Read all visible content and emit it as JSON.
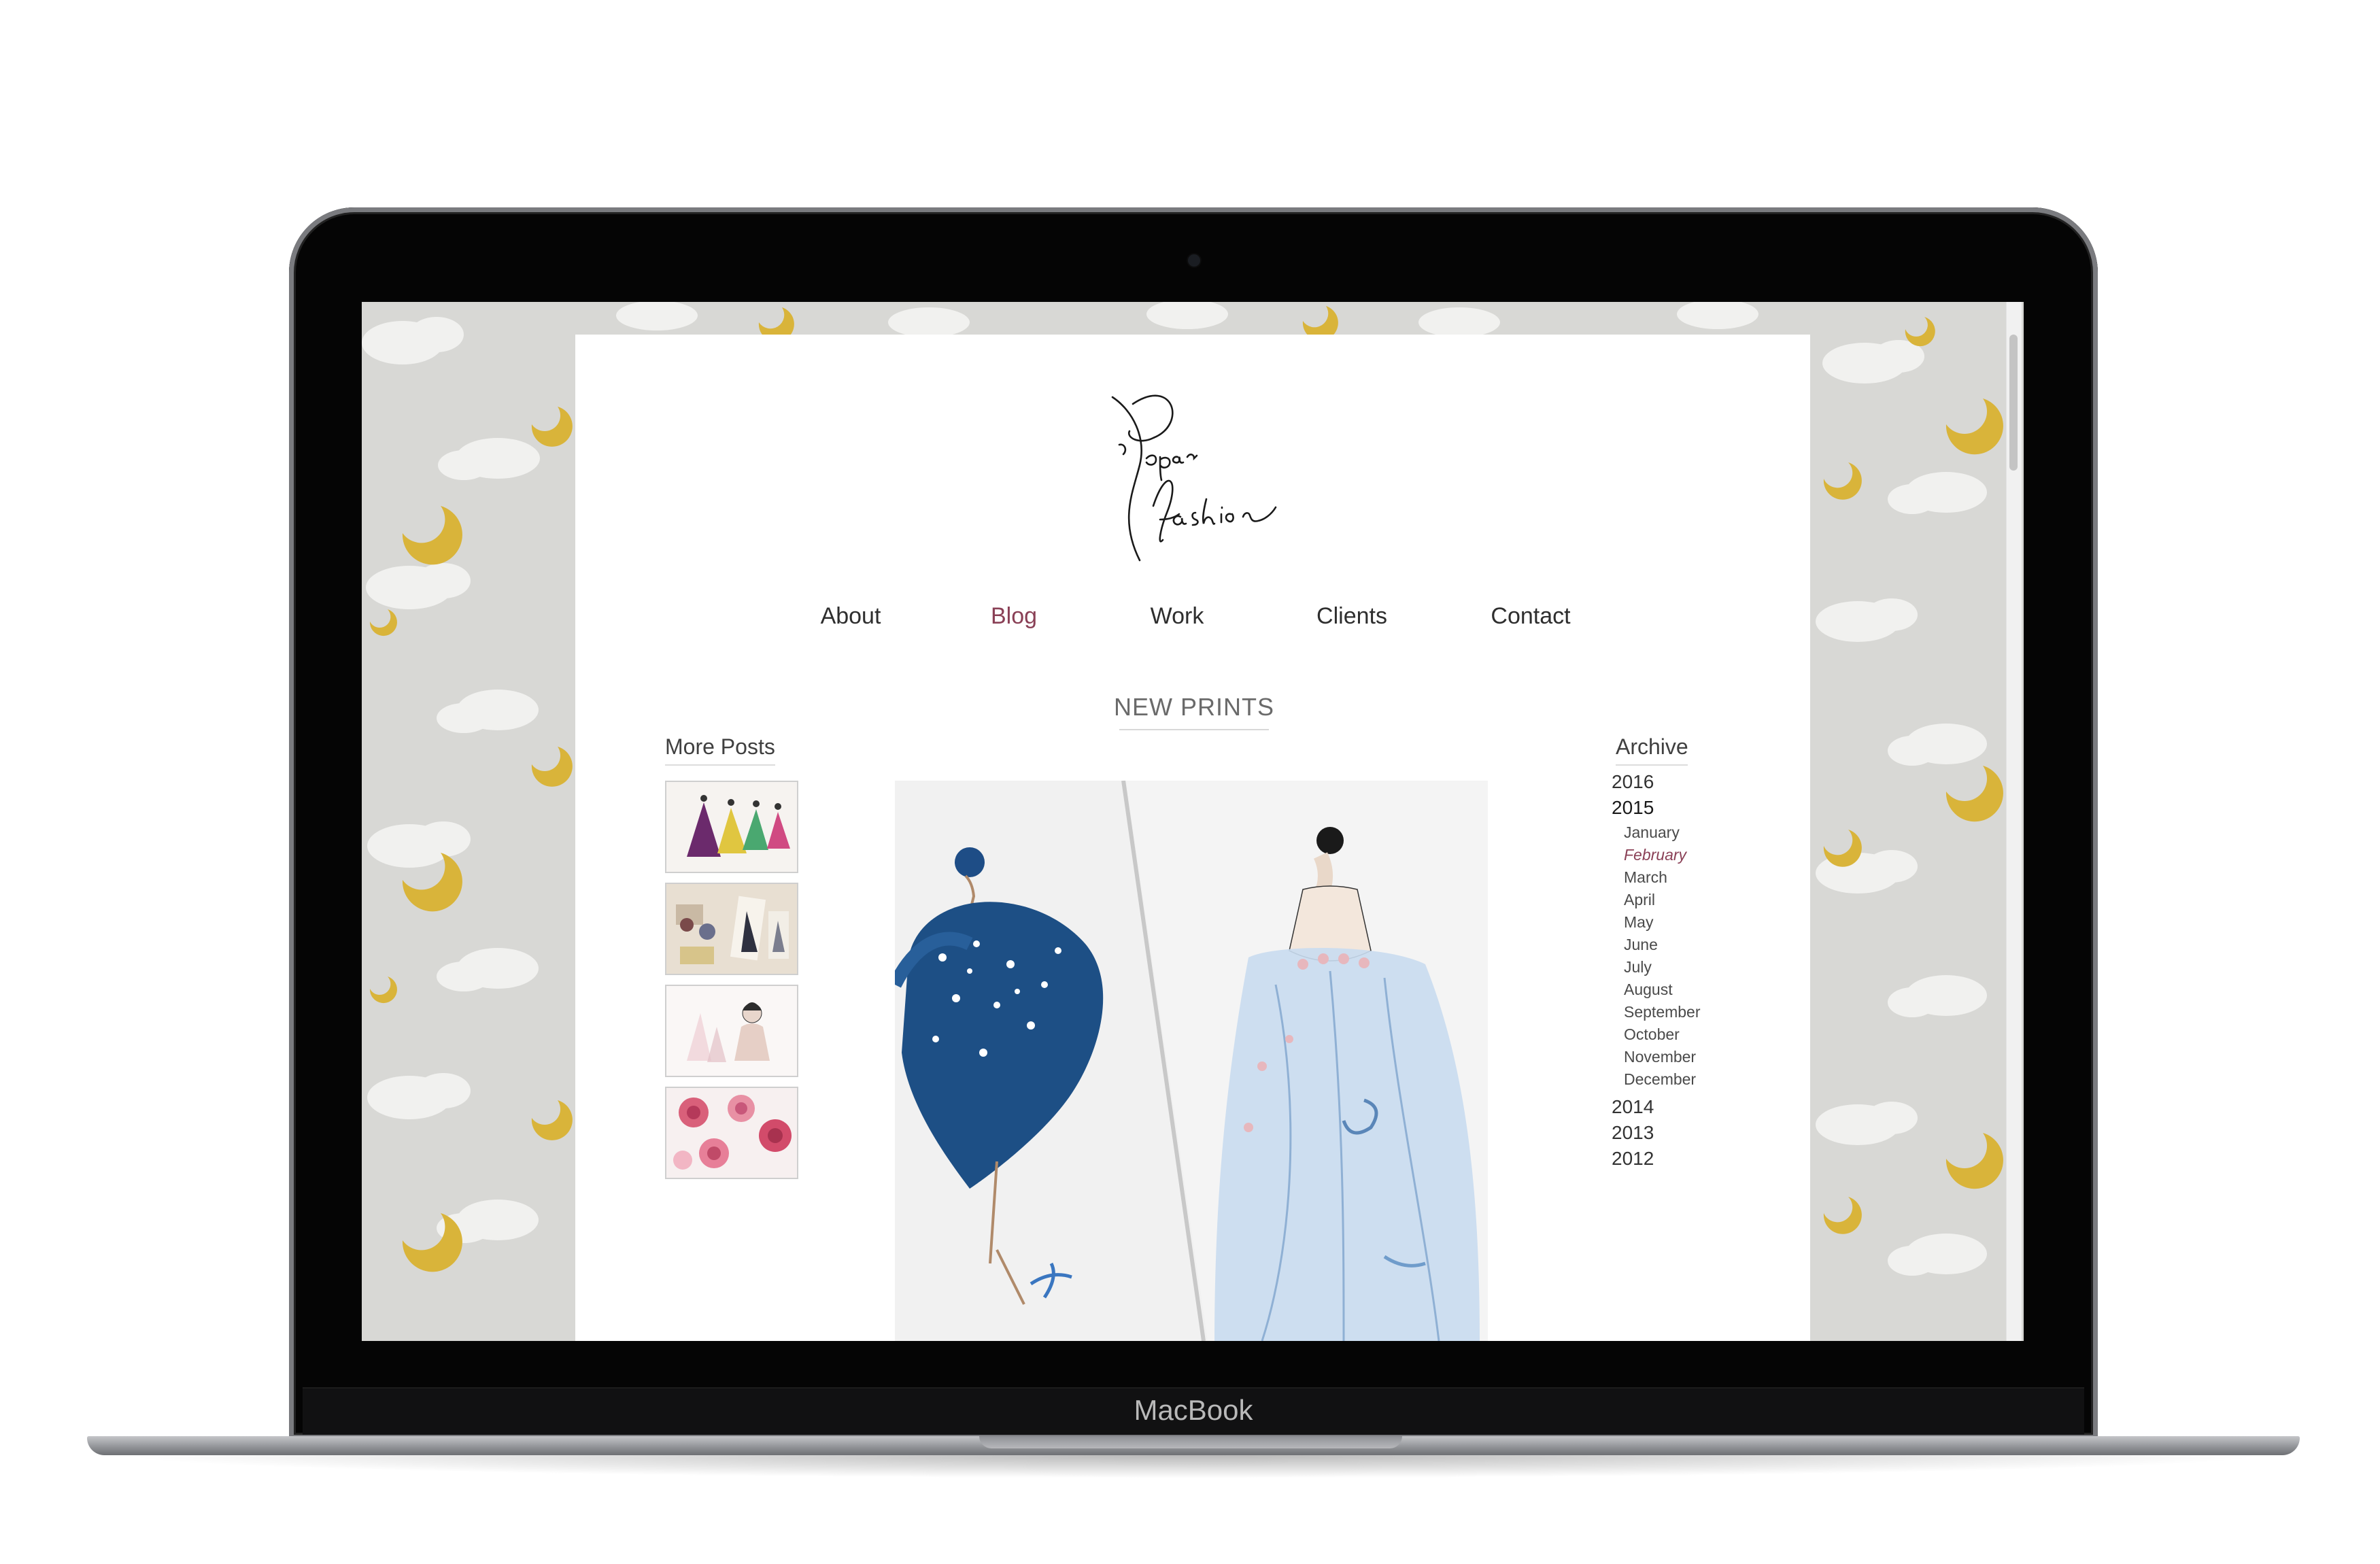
{
  "device": {
    "brand_label": "MacBook"
  },
  "site": {
    "logo_alt": "Paper fashion",
    "nav": [
      {
        "label": "About",
        "active": false
      },
      {
        "label": "Blog",
        "active": true
      },
      {
        "label": "Work",
        "active": false
      },
      {
        "label": "Clients",
        "active": false
      },
      {
        "label": "Contact",
        "active": false
      }
    ],
    "post_title": "NEW PRINTS",
    "more_posts": {
      "heading": "More Posts",
      "thumbnails": [
        {
          "name": "dress-sketches-thumbnail"
        },
        {
          "name": "craft-supplies-thumbnail"
        },
        {
          "name": "illustration-portrait-thumbnail"
        },
        {
          "name": "roses-watercolor-thumbnail"
        }
      ]
    },
    "archive": {
      "heading": "Archive",
      "years": [
        {
          "label": "2016",
          "expanded": false
        },
        {
          "label": "2015",
          "expanded": true,
          "months": [
            "January",
            "February",
            "March",
            "April",
            "May",
            "June",
            "July",
            "August",
            "September",
            "October",
            "November",
            "December"
          ],
          "active_month": "February"
        },
        {
          "label": "2014",
          "expanded": false
        },
        {
          "label": "2013",
          "expanded": false
        },
        {
          "label": "2012",
          "expanded": false
        }
      ]
    }
  },
  "colors": {
    "accent": "#8a4056",
    "text": "#2e2e2e",
    "wallpaper": "#d8d8d5",
    "moon": "#d9b43a"
  }
}
